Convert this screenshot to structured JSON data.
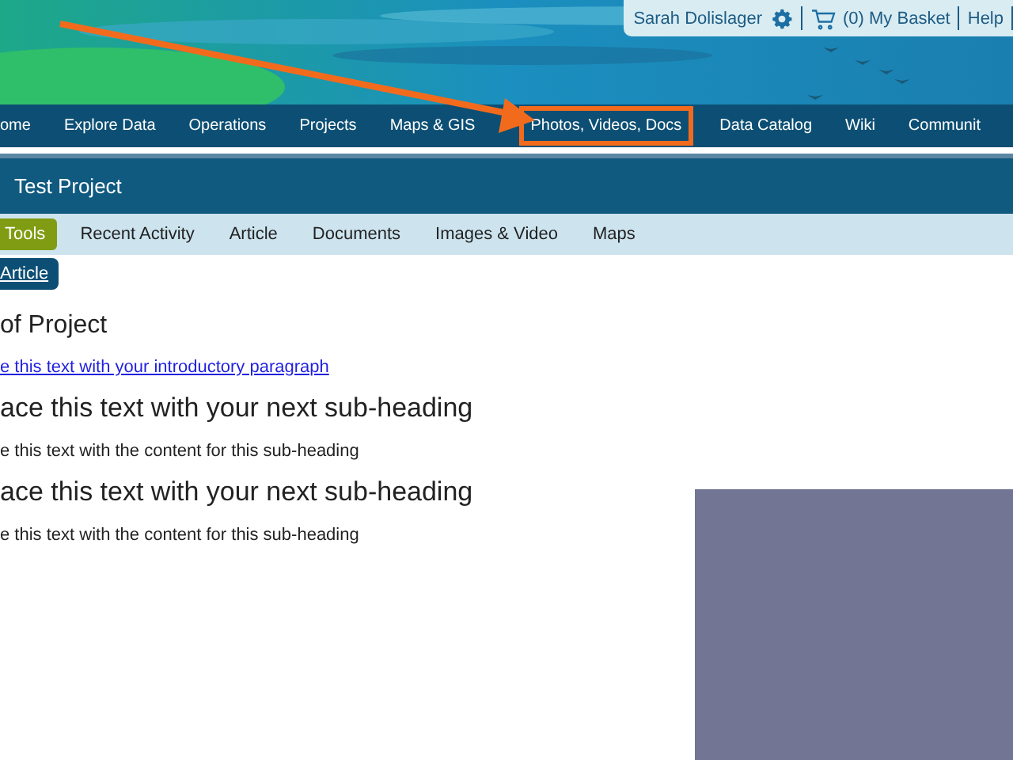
{
  "user_bar": {
    "user_name": "Sarah Dolislager",
    "basket": "(0) My Basket",
    "help": "Help"
  },
  "nav": [
    {
      "label": "ome",
      "annotated": false
    },
    {
      "label": "Explore Data",
      "annotated": false
    },
    {
      "label": "Operations",
      "annotated": false
    },
    {
      "label": "Projects",
      "annotated": false
    },
    {
      "label": "Maps & GIS",
      "annotated": false
    },
    {
      "label": "Photos, Videos, Docs",
      "annotated": true
    },
    {
      "label": "Data Catalog",
      "annotated": false
    },
    {
      "label": "Wiki",
      "annotated": false
    },
    {
      "label": "Communit",
      "annotated": false
    }
  ],
  "project_title": "Test Project",
  "tabs": [
    {
      "label": "Tools",
      "selected": true
    },
    {
      "label": "Recent Activity",
      "selected": false
    },
    {
      "label": "Article",
      "selected": false
    },
    {
      "label": "Documents",
      "selected": false
    },
    {
      "label": "Images & Video",
      "selected": false
    },
    {
      "label": "Maps",
      "selected": false
    }
  ],
  "article_button": "Article",
  "content": [
    {
      "kind": "heading",
      "text": "of Project"
    },
    {
      "kind": "link",
      "text": "e this text with your introductory paragraph"
    },
    {
      "kind": "subheading",
      "text": "ace this text with your next sub-heading"
    },
    {
      "kind": "paragraph",
      "text": "e this text with the content for this sub-heading"
    },
    {
      "kind": "subheading",
      "text": "ace this text with your next sub-heading"
    },
    {
      "kind": "paragraph",
      "text": "e this text with the content for this sub-heading"
    }
  ]
}
